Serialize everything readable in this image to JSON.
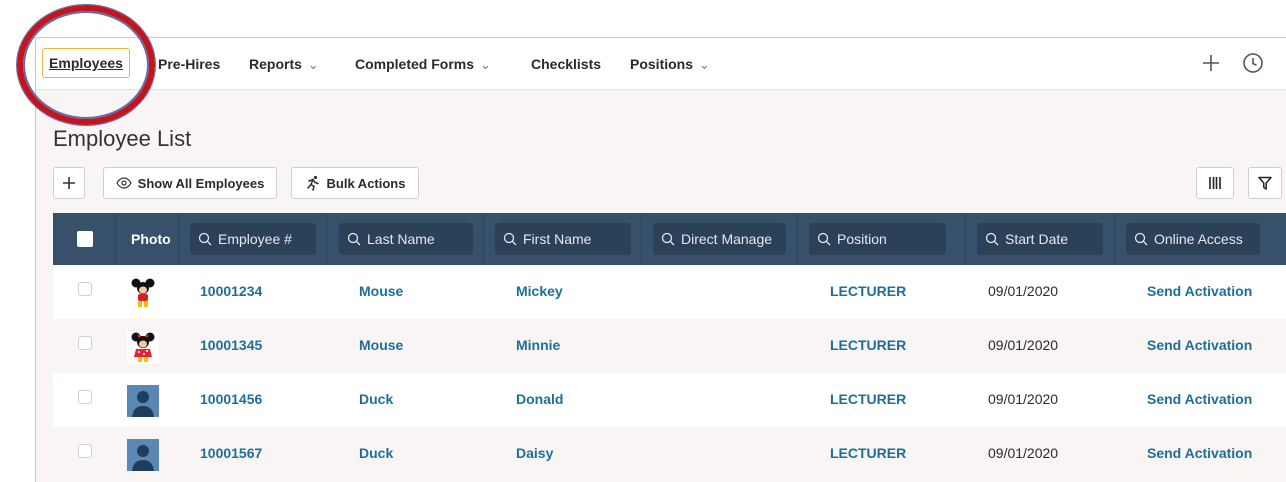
{
  "nav": {
    "active": "Employees",
    "items": [
      {
        "label": "Pre-Hires",
        "dropdown": false
      },
      {
        "label": "Reports",
        "dropdown": true
      },
      {
        "label": "Completed Forms",
        "dropdown": true
      },
      {
        "label": "Checklists",
        "dropdown": false
      },
      {
        "label": "Positions",
        "dropdown": true
      }
    ],
    "right_icons": [
      "plus-icon",
      "clock-icon"
    ]
  },
  "page": {
    "title": "Employee List"
  },
  "toolbar": {
    "add_icon": "plus-icon",
    "show_all_label": "Show All Employees",
    "bulk_actions_label": "Bulk Actions",
    "columns_icon": "columns-icon",
    "filter_icon": "filter-icon"
  },
  "table": {
    "photo_header": "Photo",
    "search_columns": [
      "Employee #",
      "Last Name",
      "First Name",
      "Direct Manage",
      "Position",
      "Start Date",
      "Online Access"
    ],
    "rows": [
      {
        "photo": "mickey-photo",
        "employee_no": "10001234",
        "last_name": "Mouse",
        "first_name": "Mickey",
        "direct_manager": "",
        "position": "LECTURER",
        "start_date": "09/01/2020",
        "online_access": "Send Activation"
      },
      {
        "photo": "minnie-photo",
        "employee_no": "10001345",
        "last_name": "Mouse",
        "first_name": "Minnie",
        "direct_manager": "",
        "position": "LECTURER",
        "start_date": "09/01/2020",
        "online_access": "Send Activation"
      },
      {
        "photo": "default-avatar",
        "employee_no": "10001456",
        "last_name": "Duck",
        "first_name": "Donald",
        "direct_manager": "",
        "position": "LECTURER",
        "start_date": "09/01/2020",
        "online_access": "Send Activation"
      },
      {
        "photo": "default-avatar",
        "employee_no": "10001567",
        "last_name": "Duck",
        "first_name": "Daisy",
        "direct_manager": "",
        "position": "LECTURER",
        "start_date": "09/01/2020",
        "online_access": "Send Activation"
      }
    ]
  },
  "colors": {
    "header_bg": "#37506b",
    "search_bg": "#2b4158",
    "link": "#1d6f9a",
    "active_border": "#e8b93c",
    "annotation": "#c4151c"
  }
}
